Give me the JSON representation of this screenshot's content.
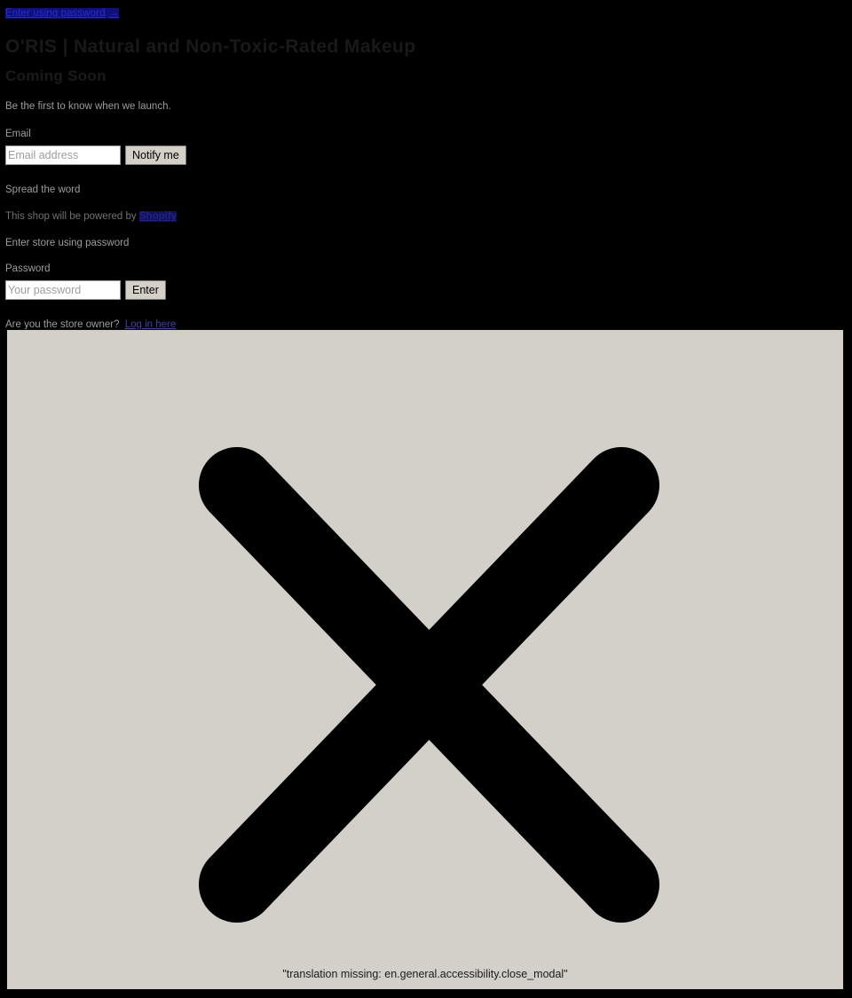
{
  "page": {
    "background_color": "#000000",
    "text_color": "#d8d8d8"
  },
  "top_bar": {
    "enter_password_link": "Enter using password",
    "arrow_glyph": "→"
  },
  "header": {
    "shop_title": "O'RIS | Natural and Non-Toxic-Rated Makeup",
    "coming_soon": "Coming Soon"
  },
  "signup": {
    "lead": "Be the first to know when we launch.",
    "email_label": "Email",
    "email_placeholder": "Email address",
    "notify_button": "Notify me"
  },
  "share": {
    "spread_heading": "Spread the word"
  },
  "powered": {
    "prefix": "This shop will be powered by",
    "link_label": "Shopify",
    "link_color": "#3a3ae0"
  },
  "password_section": {
    "heading": "Enter store using password",
    "password_label": "Password",
    "password_placeholder": "Your password",
    "enter_button": "Enter",
    "owner_question": "Are you the store owner?",
    "owner_link": "Log in here"
  },
  "modal": {
    "background_color": "#d3d0ca",
    "border_color": "#0a0a0a",
    "close_icon_name": "close-x-icon",
    "close_icon_color": "#000000",
    "caption": "\"translation missing: en.general.accessibility.close_modal\""
  }
}
